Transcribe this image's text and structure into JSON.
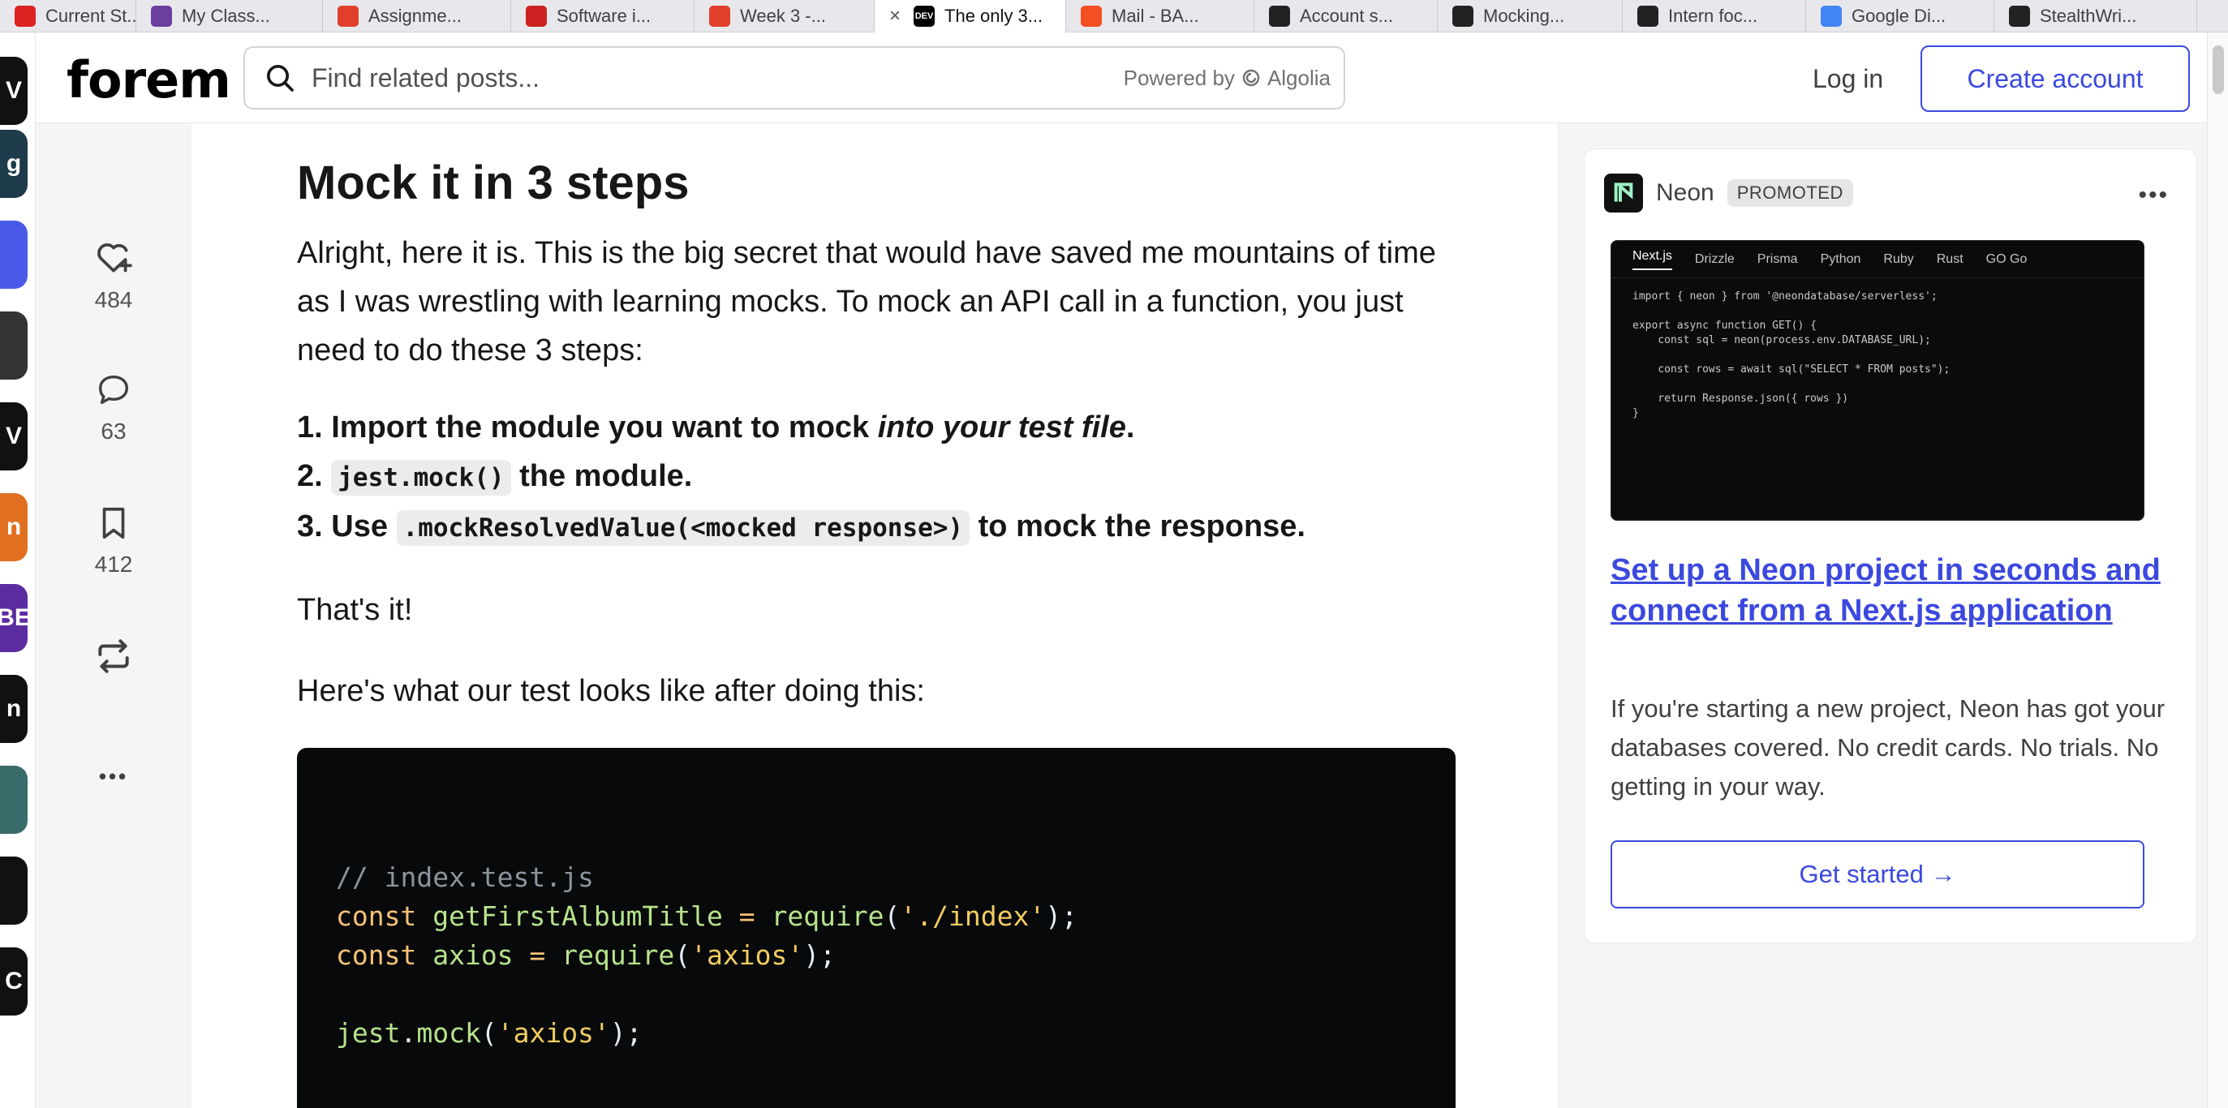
{
  "browser": {
    "tabs": [
      {
        "label": "Current St...",
        "color": "#d22"
      },
      {
        "label": "My Class...",
        "color": "#6b3fa0"
      },
      {
        "label": "Assignme...",
        "color": "#e0402b"
      },
      {
        "label": "Software i...",
        "color": "#c22"
      },
      {
        "label": "Week 3 -...",
        "color": "#e0402b"
      },
      {
        "label": "The only 3...",
        "color": "#000",
        "badge": "DEV",
        "close": "×"
      },
      {
        "label": "Mail - BA...",
        "color": "#f25022"
      },
      {
        "label": "Account s...",
        "color": "#222"
      },
      {
        "label": "Mocking...",
        "color": "#222"
      },
      {
        "label": "Intern foc...",
        "color": "#222"
      },
      {
        "label": "Google Di...",
        "color": "#4285f4"
      },
      {
        "label": "StealthWri...",
        "color": "#222"
      }
    ]
  },
  "rail_icons": [
    {
      "text": "V",
      "color": "#111"
    },
    {
      "text": "g",
      "color": "#1d3b4a"
    },
    {
      "text": "",
      "color": "#4a5ae8"
    },
    {
      "text": "",
      "color": "#333"
    },
    {
      "text": "V",
      "color": "#111"
    },
    {
      "text": "n",
      "color": "#e07020"
    },
    {
      "text": "BE",
      "color": "#5b2ca0"
    },
    {
      "text": "n",
      "color": "#111"
    },
    {
      "text": "",
      "color": "#3a6b6b"
    },
    {
      "text": "",
      "color": "#111"
    },
    {
      "text": "C",
      "color": "#111"
    }
  ],
  "header": {
    "logo": "forem",
    "search_placeholder": "Find related posts...",
    "powered_by": "Powered by",
    "powered_brand": "Algolia",
    "login": "Log in",
    "create_account": "Create account"
  },
  "reactions": {
    "likes": "484",
    "comments": "63",
    "bookmarks": "412",
    "more": "•••"
  },
  "article": {
    "heading": "Mock it in 3 steps",
    "intro": "Alright, here it is. This is the big secret that would have saved me mountains of time as I was wrestling with learning mocks. To mock an API call in a function, you just need to do these 3 steps:",
    "step1_prefix": "1. Import the module you want to mock ",
    "step1_italic": "into your test file",
    "step1_suffix": ".",
    "step2_prefix": "2. ",
    "step2_code": "jest.mock()",
    "step2_suffix": " the module.",
    "step3_prefix": "3. Use ",
    "step3_code": ".mockResolvedValue(<mocked response>)",
    "step3_suffix": " to mock the response.",
    "thats_it": "That's it!",
    "lead_in": "Here's what our test looks like after doing this:",
    "code": {
      "line1": "// index.test.js",
      "line2_kw": "const",
      "line2_name": " getFirstAlbumTitle ",
      "line2_eq": "= ",
      "line2_fn": "require",
      "line2_open": "(",
      "line2_str": "'./index'",
      "line2_close": ");",
      "line3_kw": "const",
      "line3_name": " axios ",
      "line3_eq": "= ",
      "line3_fn": "require",
      "line3_open": "(",
      "line3_str": "'axios'",
      "line3_close": ");",
      "line5_obj": "jest",
      "line5_dot": ".",
      "line5_fn": "mock",
      "line5_open": "(",
      "line5_str": "'axios'",
      "line5_close": ");"
    }
  },
  "ad": {
    "brand": "Neon",
    "promoted": "PROMOTED",
    "more": "•••",
    "image_tabs": [
      "Next.js",
      "Drizzle",
      "Prisma",
      "Python",
      "Ruby",
      "Rust",
      "GO Go"
    ],
    "image_code": "import { neon } from '@neondatabase/serverless';\n\nexport async function GET() {\n    const sql = neon(process.env.DATABASE_URL);\n\n    const rows = await sql(\"SELECT * FROM posts\");\n\n    return Response.json({ rows })\n}",
    "title": "Set up a Neon project in seconds and connect from a Next.js application",
    "description": "If you're starting a new project, Neon has got your databases covered. No credit cards. No trials. No getting in your way.",
    "cta": "Get started →"
  }
}
